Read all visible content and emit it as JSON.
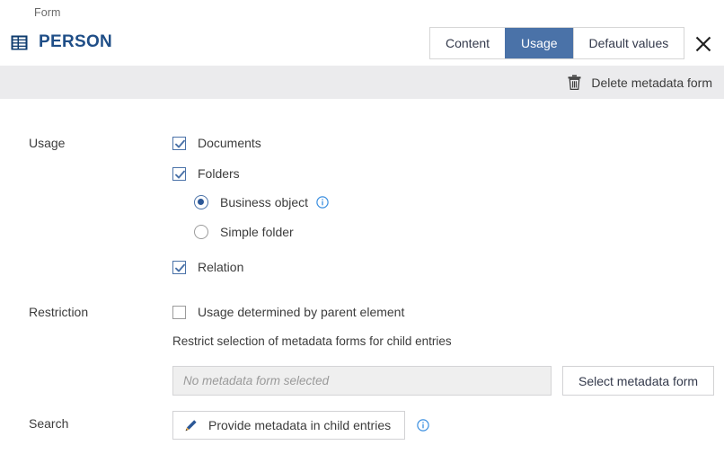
{
  "header": {
    "breadcrumb": "Form",
    "title": "PERSON",
    "title_icon": "table-form-icon",
    "close_icon": "close-icon",
    "tabs": [
      {
        "label": "Content",
        "active": false
      },
      {
        "label": "Usage",
        "active": true
      },
      {
        "label": "Default values",
        "active": false
      }
    ]
  },
  "toolbar": {
    "delete_label": "Delete metadata form",
    "delete_icon": "trash-icon"
  },
  "form": {
    "usage": {
      "label": "Usage",
      "options": [
        {
          "label": "Documents",
          "type": "checkbox",
          "checked": true
        },
        {
          "label": "Folders",
          "type": "checkbox",
          "checked": true
        },
        {
          "label": "Business object",
          "type": "radio",
          "selected": true,
          "info": true
        },
        {
          "label": "Simple folder",
          "type": "radio",
          "selected": false,
          "info": false
        },
        {
          "label": "Relation",
          "type": "checkbox",
          "checked": true
        }
      ]
    },
    "restriction": {
      "label": "Restriction",
      "parent_checkbox": {
        "label": "Usage determined by parent element",
        "checked": false
      },
      "helper": "Restrict selection of metadata forms for child entries",
      "input_placeholder": "No metadata form selected",
      "input_value": "",
      "select_button": "Select metadata form"
    },
    "search": {
      "label": "Search",
      "button_label": "Provide metadata in child entries",
      "button_icon": "pencil-icon",
      "info_icon": "info-icon"
    }
  },
  "colors": {
    "accent": "#4a72a8",
    "title": "#1f4e87",
    "toolbar_bg": "#ebebed",
    "info": "#3b8fe0"
  }
}
